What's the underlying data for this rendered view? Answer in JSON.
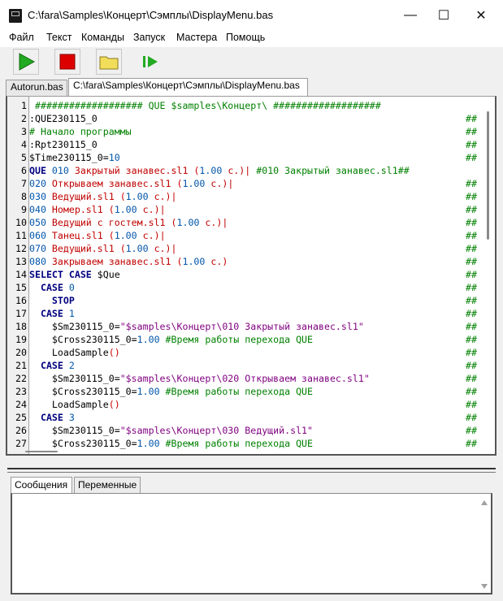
{
  "window": {
    "title": "C:\\fara\\Samples\\Концерт\\Сэмплы\\DisplayMenu.bas",
    "minimize_glyph": "—",
    "maximize_glyph": "☐",
    "close_glyph": "✕"
  },
  "menu": [
    "Файл",
    "Текст",
    "Команды",
    "Запуск",
    "Мастера",
    "Помощь"
  ],
  "toolbar": {
    "buttons": [
      {
        "name": "run-icon",
        "color": "#22aa22"
      },
      {
        "name": "stop-icon",
        "color": "#dd0000"
      },
      {
        "name": "open-folder-icon",
        "color": "#e8d34a"
      },
      {
        "name": "step-icon",
        "color": "#22aa22"
      }
    ]
  },
  "file_tabs": [
    {
      "label": "Autorun.bas",
      "active": false
    },
    {
      "label": "C:\\fara\\Samples\\Концерт\\Сэмплы\\DisplayMenu.bas",
      "active": true
    }
  ],
  "editor": {
    "lines": [
      {
        "n": "1",
        "segs": [
          [
            " ################### QUE $samples\\Концерт\\ ###################",
            "c"
          ]
        ],
        "hash": false
      },
      {
        "n": "2",
        "segs": [
          [
            ":QUE230115_0",
            "d"
          ]
        ],
        "hash": true
      },
      {
        "n": "3",
        "segs": [
          [
            "# Начало программы",
            "c"
          ]
        ],
        "hash": true
      },
      {
        "n": "4",
        "segs": [
          [
            ":Rpt230115_0",
            "d"
          ]
        ],
        "hash": true
      },
      {
        "n": "5",
        "segs": [
          [
            "$Time230115_0=",
            "d"
          ],
          [
            "10",
            "n"
          ]
        ],
        "hash": true
      },
      {
        "n": "6",
        "segs": [
          [
            "QUE ",
            "k"
          ],
          [
            "010 ",
            "n"
          ],
          [
            "Закрытый занавес.sl1 ",
            "r"
          ],
          [
            "(",
            "p"
          ],
          [
            "1.00 ",
            "n"
          ],
          [
            "с.)| ",
            "r"
          ],
          [
            "#010 Закрытый занавес.sl1##",
            "c"
          ]
        ],
        "hash": false
      },
      {
        "n": "7",
        "segs": [
          [
            "020 ",
            "n"
          ],
          [
            "Открываем занавес.sl1 ",
            "r"
          ],
          [
            "(",
            "p"
          ],
          [
            "1.00 ",
            "n"
          ],
          [
            "с.)|",
            "r"
          ]
        ],
        "hash": true
      },
      {
        "n": "8",
        "segs": [
          [
            "030 ",
            "n"
          ],
          [
            "Ведущий.sl1 ",
            "r"
          ],
          [
            "(",
            "p"
          ],
          [
            "1.00 ",
            "n"
          ],
          [
            "с.)|",
            "r"
          ]
        ],
        "hash": true
      },
      {
        "n": "9",
        "segs": [
          [
            "040 ",
            "n"
          ],
          [
            "Номер.sl1 ",
            "r"
          ],
          [
            "(",
            "p"
          ],
          [
            "1.00 ",
            "n"
          ],
          [
            "с.)|",
            "r"
          ]
        ],
        "hash": true
      },
      {
        "n": "10",
        "segs": [
          [
            "050 ",
            "n"
          ],
          [
            "Ведущий с гостем.sl1 ",
            "r"
          ],
          [
            "(",
            "p"
          ],
          [
            "1.00 ",
            "n"
          ],
          [
            "с.)|",
            "r"
          ]
        ],
        "hash": true
      },
      {
        "n": "11",
        "segs": [
          [
            "060 ",
            "n"
          ],
          [
            "Танец.sl1 ",
            "r"
          ],
          [
            "(",
            "p"
          ],
          [
            "1.00 ",
            "n"
          ],
          [
            "с.)|",
            "r"
          ]
        ],
        "hash": true
      },
      {
        "n": "12",
        "segs": [
          [
            "070 ",
            "n"
          ],
          [
            "Ведущий.sl1 ",
            "r"
          ],
          [
            "(",
            "p"
          ],
          [
            "1.00 ",
            "n"
          ],
          [
            "с.)|",
            "r"
          ]
        ],
        "hash": true
      },
      {
        "n": "13",
        "segs": [
          [
            "080 ",
            "n"
          ],
          [
            "Закрываем занавес.sl1 ",
            "r"
          ],
          [
            "(",
            "p"
          ],
          [
            "1.00 ",
            "n"
          ],
          [
            "с.)",
            "r"
          ]
        ],
        "hash": true
      },
      {
        "n": "14",
        "segs": [
          [
            "SELECT CASE ",
            "k"
          ],
          [
            "$Que",
            "d"
          ]
        ],
        "hash": true
      },
      {
        "n": "15",
        "segs": [
          [
            "  ",
            "d"
          ],
          [
            "CASE ",
            "k"
          ],
          [
            "0",
            "n"
          ]
        ],
        "hash": true
      },
      {
        "n": "16",
        "segs": [
          [
            "    ",
            "d"
          ],
          [
            "STOP",
            "k"
          ]
        ],
        "hash": true
      },
      {
        "n": "17",
        "segs": [
          [
            "  ",
            "d"
          ],
          [
            "CASE ",
            "k"
          ],
          [
            "1",
            "n"
          ]
        ],
        "hash": true
      },
      {
        "n": "18",
        "segs": [
          [
            "    $Sm230115_0=",
            "d"
          ],
          [
            "\"$samples\\Концерт\\010 Закрытый занавес.sl1\"",
            "s"
          ]
        ],
        "hash": true
      },
      {
        "n": "19",
        "segs": [
          [
            "    $Cross230115_0=",
            "d"
          ],
          [
            "1.00 ",
            "n"
          ],
          [
            "#Время работы перехода QUE",
            "c"
          ]
        ],
        "hash": true
      },
      {
        "n": "20",
        "segs": [
          [
            "    LoadSample",
            "d"
          ],
          [
            "()",
            "p"
          ]
        ],
        "hash": true
      },
      {
        "n": "21",
        "segs": [
          [
            "  ",
            "d"
          ],
          [
            "CASE ",
            "k"
          ],
          [
            "2",
            "n"
          ]
        ],
        "hash": true
      },
      {
        "n": "22",
        "segs": [
          [
            "    $Sm230115_0=",
            "d"
          ],
          [
            "\"$samples\\Концерт\\020 Открываем занавес.sl1\"",
            "s"
          ]
        ],
        "hash": true
      },
      {
        "n": "23",
        "segs": [
          [
            "    $Cross230115_0=",
            "d"
          ],
          [
            "1.00 ",
            "n"
          ],
          [
            "#Время работы перехода QUE",
            "c"
          ]
        ],
        "hash": true
      },
      {
        "n": "24",
        "segs": [
          [
            "    LoadSample",
            "d"
          ],
          [
            "()",
            "p"
          ]
        ],
        "hash": true
      },
      {
        "n": "25",
        "segs": [
          [
            "  ",
            "d"
          ],
          [
            "CASE ",
            "k"
          ],
          [
            "3",
            "n"
          ]
        ],
        "hash": true
      },
      {
        "n": "26",
        "segs": [
          [
            "    $Sm230115_0=",
            "d"
          ],
          [
            "\"$samples\\Концерт\\030 Ведущий.sl1\"",
            "s"
          ]
        ],
        "hash": true
      },
      {
        "n": "27",
        "segs": [
          [
            "    $Cross230115_0=",
            "d"
          ],
          [
            "1.00 ",
            "n"
          ],
          [
            "#Время работы перехода QUE",
            "c"
          ]
        ],
        "hash": true
      }
    ],
    "hash_marker": "##"
  },
  "bottom_tabs": [
    {
      "label": "Сообщения",
      "active": true
    },
    {
      "label": "Переменные",
      "active": false
    }
  ]
}
